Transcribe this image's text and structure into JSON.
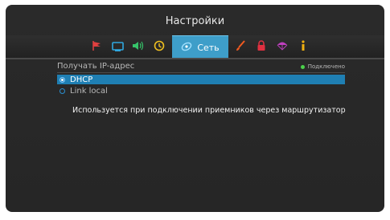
{
  "header": {
    "title": "Настройки"
  },
  "tabs": [
    {
      "icon": "flag-icon",
      "color": "#e04040"
    },
    {
      "icon": "tv-icon",
      "color": "#2fa8e0"
    },
    {
      "icon": "sound-icon",
      "color": "#36c46a"
    },
    {
      "icon": "clock-icon",
      "color": "#f0c020"
    },
    {
      "icon": "network-icon",
      "label": "Сеть",
      "color": "#3e9ec9",
      "active": true
    },
    {
      "icon": "brush-icon",
      "color": "#f05a20"
    },
    {
      "icon": "lock-icon",
      "color": "#e03040"
    },
    {
      "icon": "parachute-icon",
      "color": "#c040c0"
    },
    {
      "icon": "info-icon",
      "color": "#f0b010"
    }
  ],
  "settings": {
    "ip_label": "Получать IP-адрес",
    "status": "Подключено",
    "status_color": "#4bd04b",
    "options": [
      {
        "label": "DHCP",
        "selected": true
      },
      {
        "label": "Link local",
        "selected": false
      }
    ],
    "description": "Используется при подключении приемников через маршрутизатор"
  }
}
